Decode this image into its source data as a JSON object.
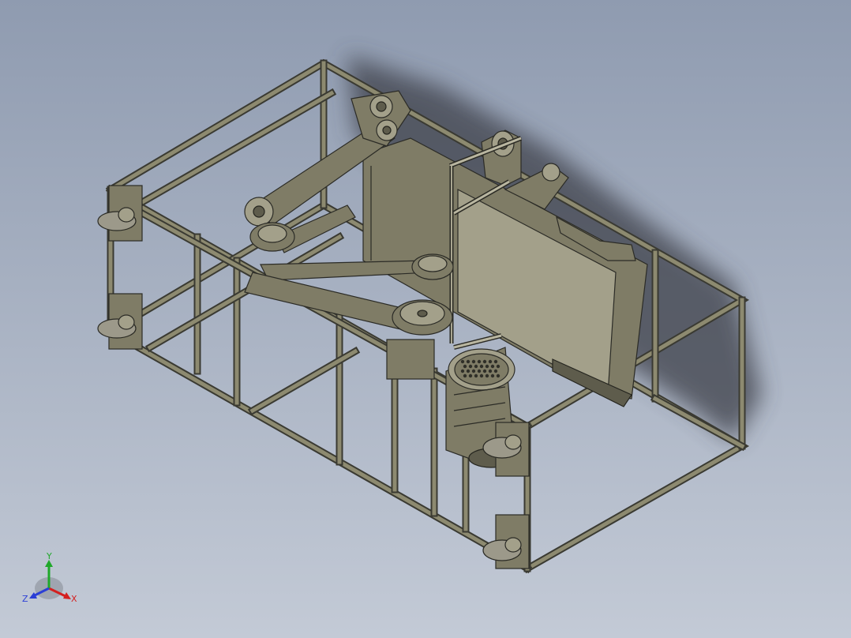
{
  "viewport": {
    "background_top": "#8f9bb0",
    "background_bottom": "#c3cad6",
    "model_color": "#7f7c66",
    "edge_color": "#2a2a24"
  },
  "model": {
    "parts": [
      "frame",
      "motor",
      "pulleys",
      "v-belts",
      "linkage-arms",
      "tank",
      "pillow-block-bearing",
      "shaft",
      "casters"
    ]
  },
  "triad": {
    "y_label": "Y",
    "x_label": "X",
    "z_label": "Z",
    "x_color": "#d42020",
    "y_color": "#1fa82a",
    "z_color": "#2b3fd6"
  }
}
